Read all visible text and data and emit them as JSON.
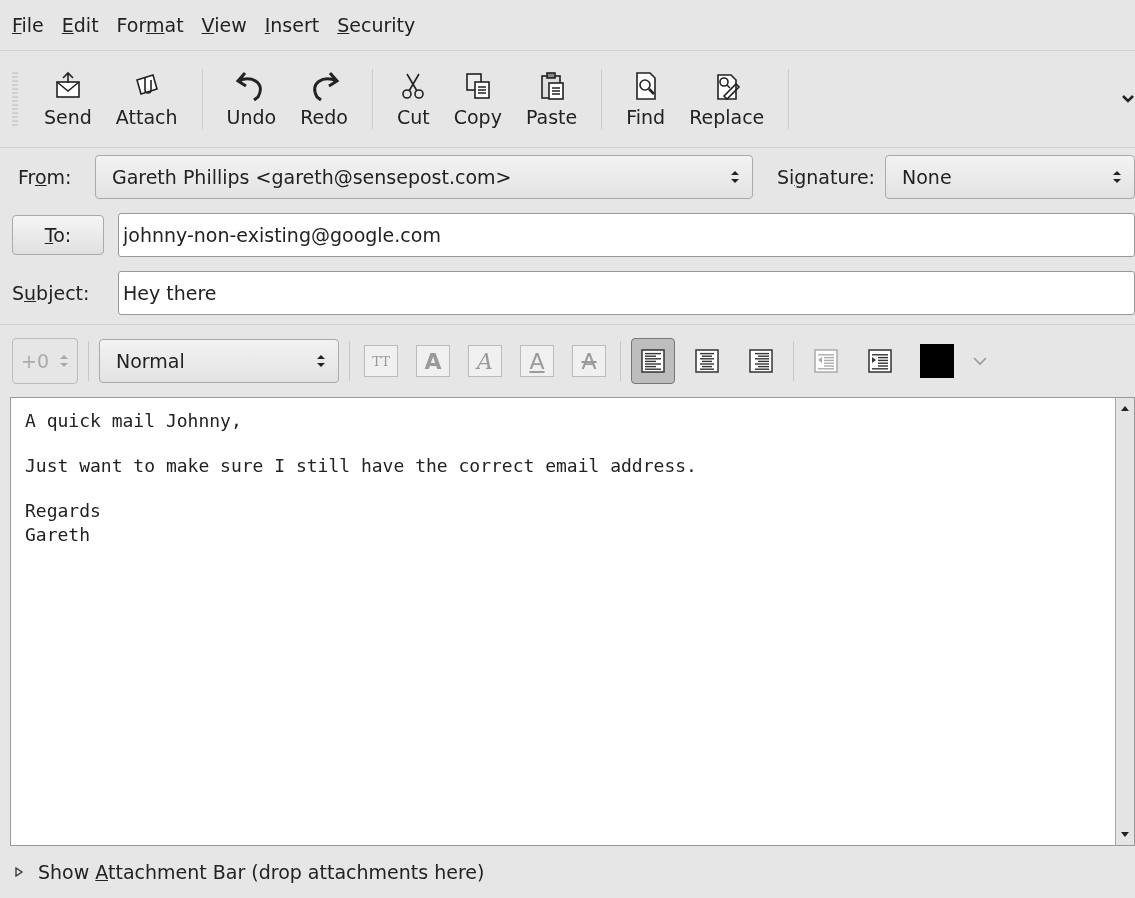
{
  "menu": [
    {
      "label": {
        "key": "F",
        "post": "ile"
      }
    },
    {
      "label": {
        "key": "E",
        "post": "dit"
      }
    },
    {
      "label": {
        "pre": "For",
        "key": "m",
        "post": "at"
      }
    },
    {
      "label": {
        "key": "V",
        "post": "iew"
      }
    },
    {
      "label": {
        "key": "I",
        "post": "nsert"
      }
    },
    {
      "label": {
        "key": "S",
        "post": "ecurity"
      }
    }
  ],
  "toolbar": [
    {
      "kind": "send",
      "label": "Send"
    },
    {
      "kind": "attach",
      "label": "Attach"
    },
    {
      "kind": "separator"
    },
    {
      "kind": "undo",
      "label": "Undo"
    },
    {
      "kind": "redo",
      "label": "Redo"
    },
    {
      "kind": "separator"
    },
    {
      "kind": "cut",
      "label": "Cut"
    },
    {
      "kind": "copy",
      "label": "Copy"
    },
    {
      "kind": "paste",
      "label": "Paste"
    },
    {
      "kind": "separator"
    },
    {
      "kind": "find",
      "label": "Find"
    },
    {
      "kind": "replace",
      "label": "Replace"
    },
    {
      "kind": "separator"
    }
  ],
  "from": {
    "label": {
      "pre": "Fr",
      "key": "o",
      "post": "m:"
    },
    "value": "Gareth Phillips <gareth@sensepost.com>"
  },
  "signature": {
    "label": {
      "pre": "Si",
      "key": "g",
      "post": "nature:"
    },
    "value": "None"
  },
  "to": {
    "label": {
      "key": "T",
      "post": "o:"
    },
    "value": "johnny-non-existing@google.com"
  },
  "subject": {
    "label": {
      "pre": "S",
      "key": "u",
      "post": "bject:"
    },
    "value": "Hey there"
  },
  "format_bar": {
    "size": {
      "value": "+0",
      "disabled": true
    },
    "paragraph_style": "Normal",
    "text_buttons": [
      {
        "kind": "tt",
        "glyph": "TT",
        "disabled": true
      },
      {
        "kind": "bold",
        "glyph": "A",
        "disabled": true
      },
      {
        "kind": "italic",
        "glyph": "A",
        "disabled": true
      },
      {
        "kind": "underline",
        "glyph": "A",
        "disabled": true
      },
      {
        "kind": "strike",
        "glyph": "A",
        "disabled": true
      }
    ],
    "align_buttons": [
      {
        "kind": "left",
        "selected": true
      },
      {
        "kind": "center",
        "selected": false
      },
      {
        "kind": "right",
        "selected": false
      }
    ],
    "indent_buttons": [
      {
        "kind": "outdent",
        "disabled": true
      },
      {
        "kind": "indent",
        "disabled": false
      }
    ]
  },
  "body": [
    [
      "A quick mail Johnny,"
    ],
    [
      "Just want to make sure I still have the correct email address."
    ],
    [
      "Regards",
      "Gareth"
    ]
  ],
  "attachment_bar": {
    "label": {
      "pre": "Show ",
      "key": "A",
      "post": "ttachment Bar (drop attachments here)"
    },
    "expanded": false
  }
}
